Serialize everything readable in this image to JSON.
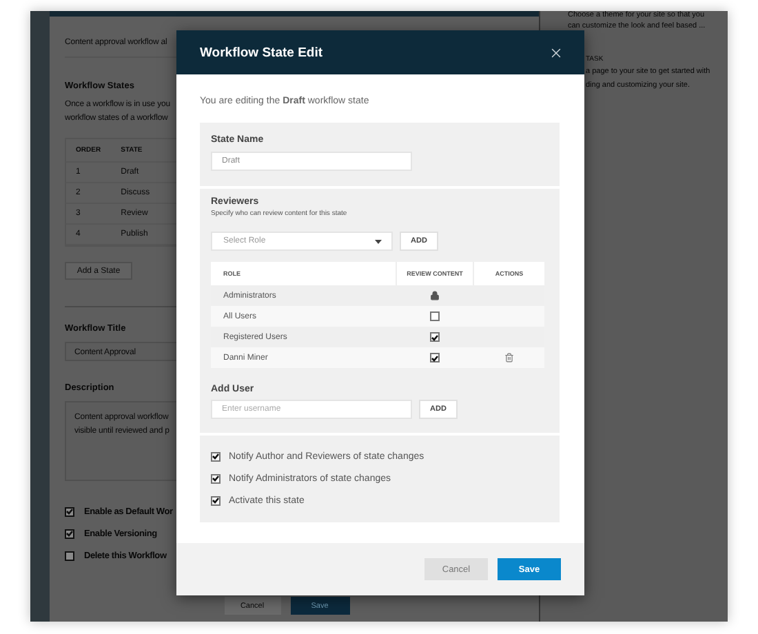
{
  "background": {
    "intro_text": "Content approval workflow al",
    "states_heading": "Workflow States",
    "states_help": [
      "Once a workflow is in use you",
      "workflow states of a workflow"
    ],
    "states_table": {
      "columns": [
        "ORDER",
        "STATE"
      ],
      "rows": [
        {
          "order": "1",
          "state": "Draft"
        },
        {
          "order": "2",
          "state": "Discuss"
        },
        {
          "order": "3",
          "state": "Review"
        },
        {
          "order": "4",
          "state": "Publish"
        }
      ]
    },
    "add_state_button": "Add a State",
    "title_field": {
      "label": "Workflow Title",
      "value": "Content Approval"
    },
    "description_field": {
      "label": "Description",
      "lines": [
        "Content approval workflow",
        "visible until reviewed and p"
      ]
    },
    "options": [
      {
        "label": "Enable as Default Wor",
        "checked": true
      },
      {
        "label": "Enable Versioning",
        "checked": true
      },
      {
        "label": "Delete this Workflow",
        "checked": false
      }
    ],
    "buttons": [
      {
        "label": "Cancel",
        "kind": "secondary"
      },
      {
        "label": "Save",
        "kind": "primary"
      }
    ],
    "side_panel": {
      "theme_lines": [
        "Choose a theme for your site so that you",
        "can customize the look and feel based ..."
      ],
      "task_label": "TASK",
      "task_lines": [
        "a page to your site to get started with",
        "ding and customizing your site."
      ]
    }
  },
  "dialog": {
    "title": "Workflow State Edit",
    "intro": "You are editing the **Draft** workflow state",
    "state_name": {
      "label": "State Name",
      "value": "Draft"
    },
    "reviewers": {
      "title": "Reviewers",
      "subtitle": "Specify who can review content for this state",
      "role_select": {
        "placeholder": "Select Role"
      },
      "add_button": "ADD",
      "columns": [
        "ROLE",
        "REVIEW CONTENT",
        "ACTIONS"
      ],
      "rows": [
        {
          "role": "Administrators",
          "kind": "locked",
          "removable": false
        },
        {
          "role": "All Users",
          "kind": "checkbox",
          "checked": false,
          "removable": false
        },
        {
          "role": "Registered Users",
          "kind": "checkbox",
          "checked": true,
          "removable": false
        },
        {
          "role": "Danni Miner",
          "kind": "checkbox",
          "checked": true,
          "removable": true
        }
      ],
      "add_user": {
        "label": "Add User",
        "placeholder": "Enter username",
        "button": "ADD"
      }
    },
    "notifications": [
      {
        "label": "Notify Author and Reviewers of state changes",
        "checked": true
      },
      {
        "label": "Notify Administrators of state changes",
        "checked": true
      },
      {
        "label": "Activate this state",
        "checked": true
      }
    ],
    "buttons": [
      {
        "label": "Cancel",
        "kind": "secondary"
      },
      {
        "label": "Save",
        "kind": "primary"
      }
    ]
  }
}
